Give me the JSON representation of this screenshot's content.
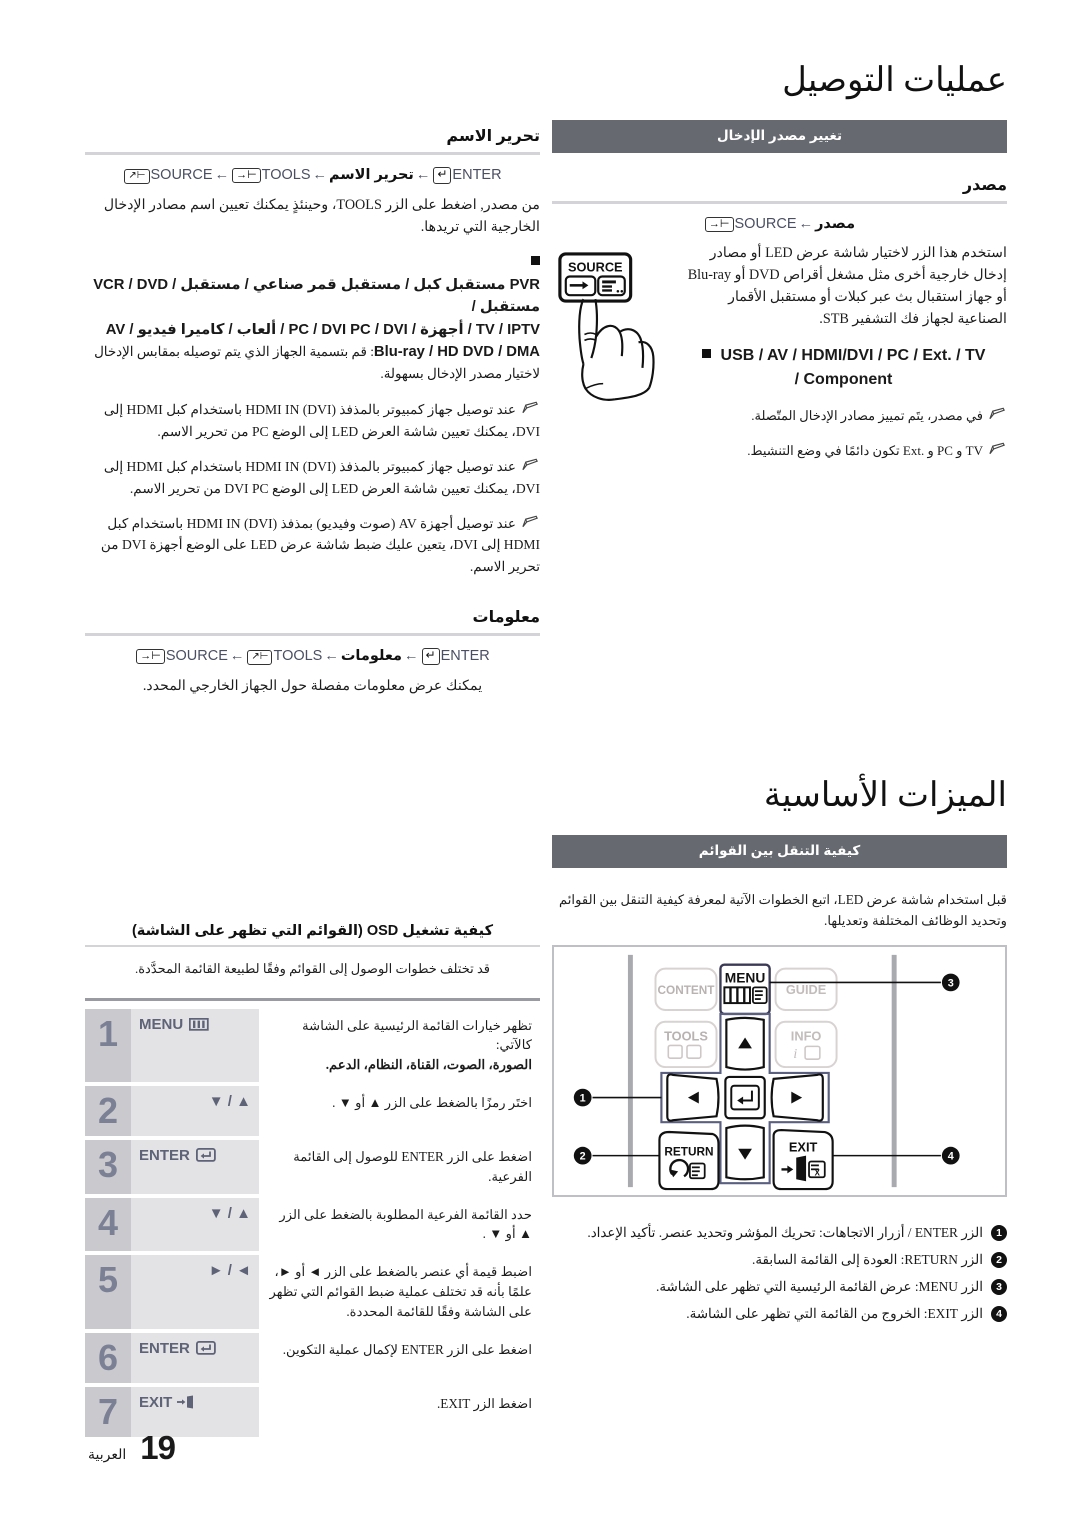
{
  "page": {
    "number": "19",
    "language_label": "العربية"
  },
  "left_column": {
    "section_title": "",
    "edit_name": {
      "heading": "تحرير الاسم",
      "nav_path": {
        "source": "SOURCE",
        "tools": "TOOLS",
        "target": "تحرير الاسم",
        "enter": "ENTER"
      },
      "intro": "من مصدر, اضغط على الزر  TOOLS، وحينئذٍ يمكنك تعيين اسم مصادر الإدخال الخارجية التي تريدها.",
      "device_list_line1": "VCR / DVD / مستقبل كبل / مستقبل قمر صناعي / مستقبل PVR / مستقبل",
      "device_list_line2": "AV / ألعاب / كاميرا فيديو / PC / DVI PC / DVI / أجهزة / TV / IPTV",
      "device_list_line3": "Blu-ray / HD DVD / DMA",
      "device_list_tail": ": قم بتسمية الجهاز الذي يتم توصيله بمقابس الإدخال لاختيار مصدر الإدخال بسهولة.",
      "notes": [
        "عند توصيل جهاز كمبيوتر بالمذفذ HDMI IN (DVI) باستخدام كبل HDMI إلى DVI، يمكنك تعيين شاشة العرض LED إلى الوضع PC من تحرير الاسم.",
        "عند توصيل جهاز كمبيوتر بالمذفذ HDMI IN (DVI) باستخدام كبل HDMI إلى DVI، يمكنك تعيين شاشة العرض LED إلى الوضع DVI PC من تحرير الاسم.",
        "عند توصيل أجهزة AV (صوت وفيديو) بمذفذ HDMI IN (DVI) باستخدام كبل HDMI إلى DVI، يتعين عليك ضبط شاشة عرض LED على الوضع أجهزة DVI من تحرير الاسم."
      ]
    },
    "information": {
      "heading": "معلومات",
      "nav_path": {
        "source": "SOURCE",
        "tools": "TOOLS",
        "target": "معلومات",
        "enter": "ENTER"
      },
      "intro": "يمكنك عرض معلومات مفصلة حول الجهاز الخارجي المحدد."
    },
    "osd": {
      "heading": "كيفية تشغيل OSD (القوائم التي تظهر على الشاشة)",
      "subtitle": "قد تختلف خطوات الوصول إلى القوائم وفقًا لطبيعة القائمة المحدَّدة.",
      "steps": [
        {
          "num": "1",
          "button": "MENU",
          "button_icon": "menu-icon",
          "desc": "تظهر خيارات القائمة الرئيسية على الشاشة كالآتي:",
          "desc_bold": "الصورة، الصوت، القناة، النظام، الدعم."
        },
        {
          "num": "2",
          "button": "▼ / ▲",
          "button_icon": "",
          "desc": "اختَر رمزًا بالضغط على الزر ▲ أو ▼ .",
          "desc_bold": ""
        },
        {
          "num": "3",
          "button": "ENTER",
          "button_icon": "enter-icon",
          "desc": "اضغط على الزر ENTER للوصول إلى القائمة الفرعية.",
          "desc_bold": ""
        },
        {
          "num": "4",
          "button": "▼ / ▲",
          "button_icon": "",
          "desc": "حدد القائمة الفرعية المطلوبة بالضغط على الزر ▲ أو ▼ .",
          "desc_bold": ""
        },
        {
          "num": "5",
          "button": "► / ◄",
          "button_icon": "",
          "desc": "اضبط قيمة أي عنصر بالضغط على الزر ◄ أو ►، علمًا بأنه قد تختلف عملية ضبط القوائم التي تظهر على الشاشة وفقًا للقائمة المحددة.",
          "desc_bold": ""
        },
        {
          "num": "6",
          "button": "ENTER",
          "button_icon": "enter-icon",
          "desc": "اضغط على الزر ENTER لإكمال عملية التكوين.",
          "desc_bold": ""
        },
        {
          "num": "7",
          "button": "EXIT",
          "button_icon": "exit-icon",
          "desc": "اضغط الزر EXIT.",
          "desc_bold": ""
        }
      ]
    }
  },
  "right_column": {
    "section_title": "عمليات التوصيل",
    "banner": "تغيير مصدر الإدخال",
    "source": {
      "heading": "مصدر",
      "nav_path": {
        "source": "SOURCE",
        "target": "مصدر"
      },
      "body": "استخدم هذا الزر لاختيار شاشة عرض LED أو مصادر إدخال خارجية أخرى مثل مشغل أقراص DVD أو Blu-ray أو جهاز استقبال بث عبر كبلات أو مستقبل الأقمار الصناعية لجهاز فك التشفير STB.",
      "device_list_line1": "USB / AV / HDMI/DVI / PC / Ext. / TV",
      "device_list_line2": "/ Component",
      "notes": [
        "في مصدر، يتَم تمييز مصادر الإدخال المتّصلة.",
        "TV و PC و .Ext تكون دائمًا في وضع التنشيط."
      ],
      "figure_label": "SOURCE"
    },
    "features": {
      "section_title": "الميزات الأساسية",
      "banner": "كيفية التنقل بين القوائم",
      "intro": "قبل استخدام شاشة عرض LED، اتبع الخطوات الآتية لمعرفة كيفية التنقل بين القوائم وتحديد الوظائف المختلفة وتعديلها.",
      "remote_buttons": {
        "content": "CONTENT",
        "menu": "MENU",
        "guide": "GUIDE",
        "tools": "TOOLS",
        "info": "INFO",
        "return": "RETURN",
        "exit": "EXIT"
      },
      "callouts": [
        "1",
        "2",
        "3",
        "4"
      ],
      "legend": [
        {
          "num": "1",
          "text": "الزر ENTER / أزرار الاتجاهات: تحريك المؤشر وتحديد عنصر. تأكيد الإعداد."
        },
        {
          "num": "2",
          "text": "الزر RETURN: العودة إلى القائمة السابقة."
        },
        {
          "num": "3",
          "text": "الزر MENU: عرض القائمة الرئيسية التي تظهر على الشاشة."
        },
        {
          "num": "4",
          "text": "الزر EXIT: الخروج من القائمة التي تظهر على الشاشة."
        }
      ]
    }
  },
  "colors": {
    "banner_gray": "#666a70",
    "step_number_bg": "#c9c9ce",
    "step_number_fg": "#7b8095",
    "step_button_bg": "#e3e3e6",
    "rule_gray": "#d4d4d8",
    "remote_border": "#bfbfc6"
  }
}
